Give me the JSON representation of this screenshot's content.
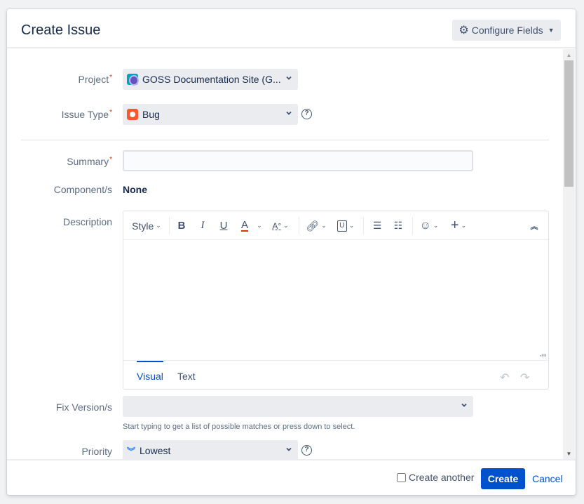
{
  "dialog": {
    "title": "Create Issue",
    "configure_fields_label": "Configure Fields"
  },
  "fields": {
    "project": {
      "label": "Project",
      "required_mark": "*",
      "value": "GOSS Documentation Site (G..."
    },
    "issue_type": {
      "label": "Issue Type",
      "required_mark": "*",
      "value": "Bug"
    },
    "summary": {
      "label": "Summary",
      "required_mark": "*",
      "value": "",
      "placeholder": ""
    },
    "components": {
      "label": "Component/s",
      "value": "None"
    },
    "description": {
      "label": "Description",
      "toolbar": {
        "style_label": "Style",
        "bold": "B",
        "italic": "I",
        "underline": "U",
        "text_color": "A",
        "more_formatting": "A°"
      },
      "modes": [
        {
          "label": "Visual",
          "active": true
        },
        {
          "label": "Text",
          "active": false
        }
      ]
    },
    "fix_versions": {
      "label": "Fix Version/s",
      "value": "",
      "hint": "Start typing to get a list of possible matches or press down to select."
    },
    "priority": {
      "label": "Priority",
      "value": "Lowest"
    }
  },
  "footer": {
    "create_another_label": "Create another",
    "create_another_checked": false,
    "create_label": "Create",
    "cancel_label": "Cancel"
  },
  "colors": {
    "primary": "#0052cc",
    "required": "#de350b",
    "bug": "#ff5630",
    "priority_lowest": "#2684ff"
  }
}
